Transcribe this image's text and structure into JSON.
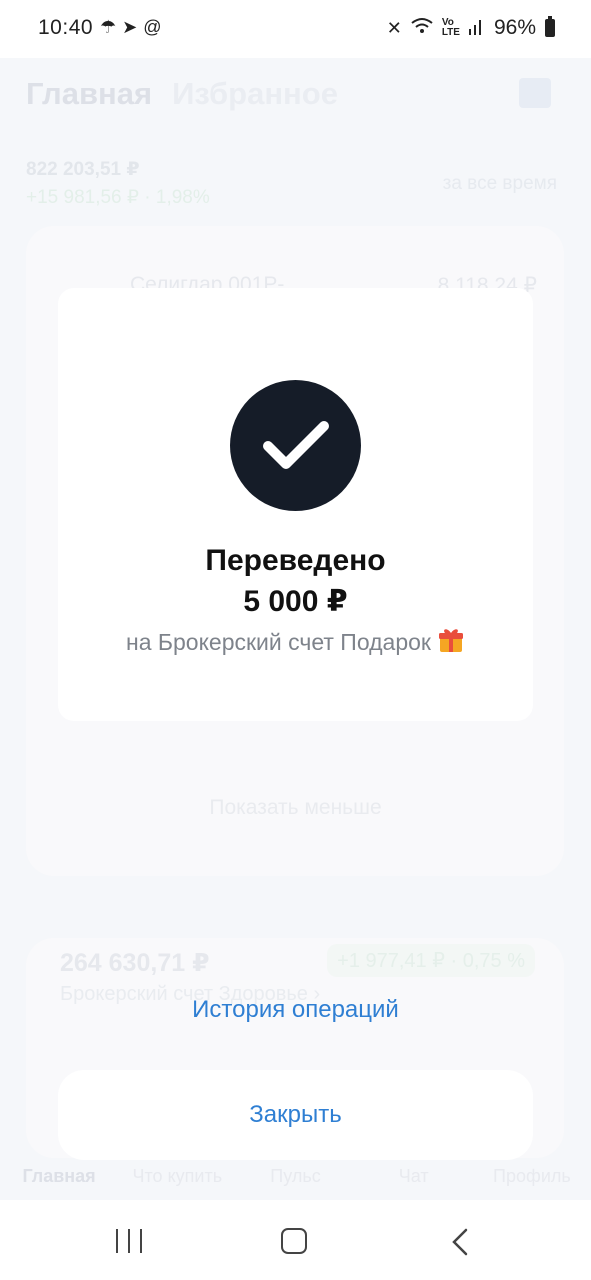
{
  "status_bar": {
    "time": "10:40",
    "battery": "96%",
    "left_icons": [
      "umbrella-icon",
      "telegram-icon",
      "at-icon"
    ],
    "right_icons": [
      "mute-icon",
      "wifi-icon",
      "volte-icon",
      "signal-icon",
      "battery-icon"
    ]
  },
  "background": {
    "tabs": [
      "Главная",
      "Избранное"
    ],
    "portfolio_total": "822 203,51 ₽",
    "portfolio_delta": "+15 981,56 ₽ · 1,98%",
    "period": "за все время",
    "first_row_name": "Селигдар 001Р-",
    "first_row_value": "8 118,24 ₽",
    "show_less": "Показать меньше",
    "account_sum": "264 630,71 ₽",
    "account_delta": "+1 977,41 ₽ · 0,75 %",
    "account_name": "Брокерский счет Здоровье ›",
    "bottom_nav": [
      "Главная",
      "Что купить",
      "Пульс",
      "Чат",
      "Профиль"
    ]
  },
  "modal": {
    "title": "Переведено",
    "amount": "5 000 ₽",
    "destination": "на Брокерский счет Подарок",
    "destination_emoji": "gift-icon"
  },
  "actions": {
    "history": "История операций",
    "close": "Закрыть"
  },
  "colors": {
    "accent": "#2f7fd3",
    "check_circle": "#151c28",
    "modal_bg": "#ffffff"
  }
}
